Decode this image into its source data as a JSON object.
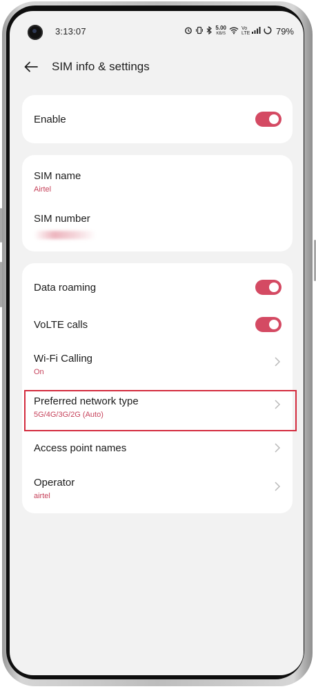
{
  "status_bar": {
    "time": "3:13:07",
    "speed_value": "5.00",
    "speed_unit": "KB/S",
    "volte_label": "Vo LTE",
    "battery_percent": "79%"
  },
  "header": {
    "title": "SIM info & settings"
  },
  "enable_card": {
    "enable_label": "Enable",
    "enable_on": true
  },
  "sim_card": {
    "sim_name_label": "SIM name",
    "sim_name_value": "Airtel",
    "sim_number_label": "SIM number"
  },
  "settings_card": {
    "data_roaming_label": "Data roaming",
    "data_roaming_on": true,
    "volte_calls_label": "VoLTE calls",
    "volte_calls_on": true,
    "wifi_calling_label": "Wi-Fi Calling",
    "wifi_calling_value": "On",
    "preferred_network_label": "Preferred network type",
    "preferred_network_value": "5G/4G/3G/2G (Auto)",
    "apn_label": "Access point names",
    "operator_label": "Operator",
    "operator_value": "airtel"
  },
  "colors": {
    "accent": "#d44a63",
    "highlight_border": "#d32a3d",
    "screen_background": "#f2f2f2",
    "card_background": "#ffffff"
  },
  "icons": [
    "camera-icon",
    "alarm-icon",
    "vibrate-icon",
    "bluetooth-icon",
    "wifi-icon",
    "signal-icon",
    "battery-icon",
    "back-arrow-icon",
    "chevron-right-icon"
  ]
}
